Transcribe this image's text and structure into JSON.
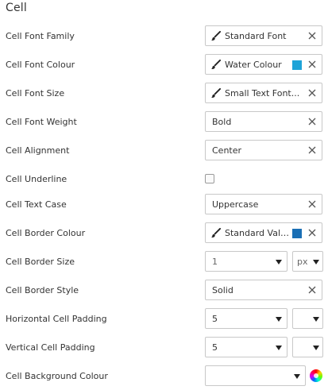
{
  "section": {
    "title": "Cell"
  },
  "rows": {
    "font_family": {
      "label": "Cell Font Family",
      "value": "Standard Font"
    },
    "font_colour": {
      "label": "Cell Font Colour",
      "value": "Water Colour",
      "swatch": "#1ea3d8"
    },
    "font_size": {
      "label": "Cell Font Size",
      "value": "Small Text Font..."
    },
    "font_weight": {
      "label": "Cell Font Weight",
      "value": "Bold"
    },
    "alignment": {
      "label": "Cell Alignment",
      "value": "Center"
    },
    "underline": {
      "label": "Cell Underline",
      "checked": false
    },
    "text_case": {
      "label": "Cell Text Case",
      "value": "Uppercase"
    },
    "border_colour": {
      "label": "Cell Border Colour",
      "value": "Standard Value...",
      "swatch": "#1a6fb5"
    },
    "border_size": {
      "label": "Cell Border Size",
      "value": "1",
      "unit": "px"
    },
    "border_style": {
      "label": "Cell Border Style",
      "value": "Solid"
    },
    "h_padding": {
      "label": "Horizontal Cell Padding",
      "value": "5",
      "unit": ""
    },
    "v_padding": {
      "label": "Vertical Cell Padding",
      "value": "5",
      "unit": ""
    },
    "background_colour": {
      "label": "Cell Background Colour",
      "value": ""
    }
  },
  "icons": {
    "brush": "paintbrush-icon",
    "clear": "close-icon",
    "caret": "chevron-down-icon",
    "wheel": "color-wheel-icon"
  }
}
